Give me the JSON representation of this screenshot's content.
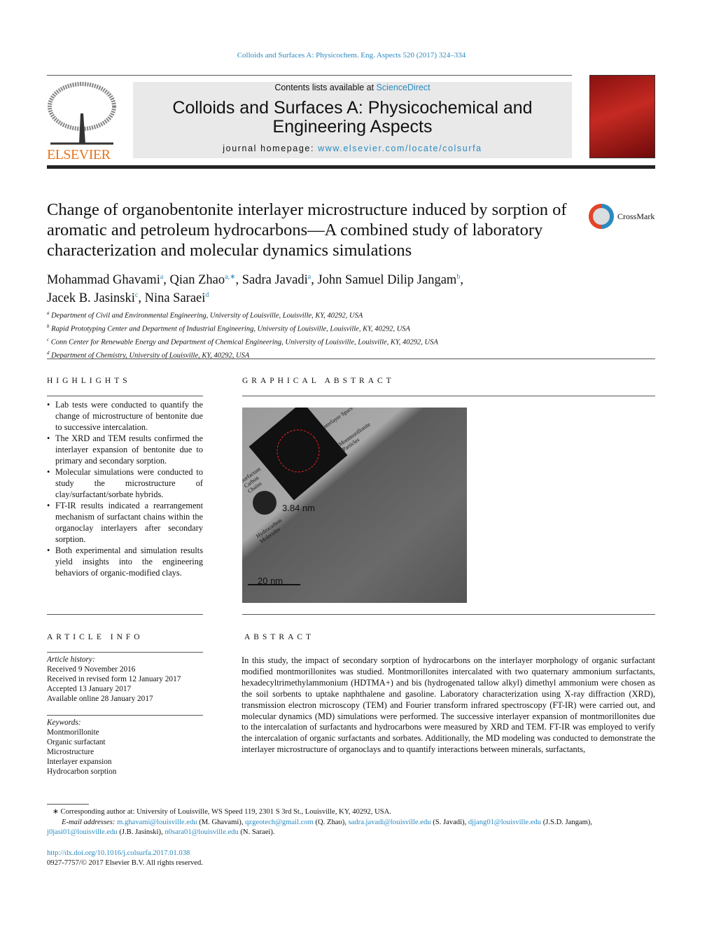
{
  "journal_ref": "Colloids and Surfaces A: Physicochem. Eng. Aspects 520 (2017) 324–334",
  "header": {
    "contents_prefix": "Contents lists available at ",
    "contents_link": "ScienceDirect",
    "journal_title": "Colloids and Surfaces A: Physicochemical and Engineering Aspects",
    "homepage_prefix": "journal homepage: ",
    "homepage_link": "www.elsevier.com/locate/colsurfa",
    "publisher_logo": "ELSEVIER"
  },
  "crossmark": "CrossMark",
  "title": "Change of organobentonite interlayer microstructure induced by sorption of aromatic and petroleum hydrocarbons—A combined study of laboratory characterization and molecular dynamics simulations",
  "authors": [
    {
      "name": "Mohammad Ghavami",
      "sup": "a"
    },
    {
      "name": "Qian Zhao",
      "sup": "a,∗"
    },
    {
      "name": "Sadra Javadi",
      "sup": "a"
    },
    {
      "name": "John Samuel Dilip Jangam",
      "sup": "b"
    },
    {
      "name": "Jacek B. Jasinski",
      "sup": "c"
    },
    {
      "name": "Nina Saraei",
      "sup": "d"
    }
  ],
  "affiliations": [
    {
      "sup": "a",
      "text": "Department of Civil and Environmental Engineering, University of Louisville, Louisville, KY, 40292, USA"
    },
    {
      "sup": "b",
      "text": "Rapid Prototyping Center and Department of Industrial Engineering, University of Louisville, Louisville, KY, 40292, USA"
    },
    {
      "sup": "c",
      "text": "Conn Center for Renewable Energy and Department of Chemical Engineering, University of Louisville, Louisville, KY, 40292, USA"
    },
    {
      "sup": "d",
      "text": "Department of Chemistry, University of Louisville, KY, 40292, USA"
    }
  ],
  "highlights": {
    "heading": "HIGHLIGHTS",
    "items": [
      "Lab tests were conducted to quantify the change of microstructure of bentonite due to successive intercalation.",
      "The XRD and TEM results confirmed the interlayer expansion of bentonite due to primary and secondary sorption.",
      "Molecular simulations were conducted to study the microstructure of clay/surfactant/sorbate hybrids.",
      "FT-IR results indicated a rearrangement mechanism of surfactant chains within the organoclay interlayers after secondary sorption.",
      "Both experimental and simulation results yield insights into the engineering behaviors of organic-modified clays."
    ]
  },
  "graphical_abstract": {
    "heading": "GRAPHICAL ABSTRACT",
    "labels": {
      "interlayer": "Interlayer Space",
      "particles": "Montmorillonite Particles",
      "chains": "Surfactant Carbon Chains",
      "hydrocarbon": "Hydrocarbon Molecules",
      "spacing": "3.84 nm",
      "scale": "20 nm"
    }
  },
  "article_info": {
    "heading": "ARTICLE INFO",
    "history_label": "Article history:",
    "history": [
      "Received 9 November 2016",
      "Received in revised form 12 January 2017",
      "Accepted 13 January 2017",
      "Available online 28 January 2017"
    ],
    "keywords_label": "Keywords:",
    "keywords": [
      "Montmorillonite",
      "Organic surfactant",
      "Microstructure",
      "Interlayer expansion",
      "Hydrocarbon sorption"
    ]
  },
  "abstract": {
    "heading": "ABSTRACT",
    "text": "In this study, the impact of secondary sorption of hydrocarbons on the interlayer morphology of organic surfactant modified montmorillonites was studied. Montmorillonites intercalated with two quaternary ammonium surfactants, hexadecyltrimethylammonium (HDTMA+) and bis (hydrogenated tallow alkyl) dimethyl ammonium were chosen as the soil sorbents to uptake naphthalene and gasoline. Laboratory characterization using X-ray diffraction (XRD), transmission electron microscopy (TEM) and Fourier transform infrared spectroscopy (FT-IR) were carried out, and molecular dynamics (MD) simulations were performed. The successive interlayer expansion of montmorillonites due to the intercalation of surfactants and hydrocarbons were measured by XRD and TEM. FT-IR was employed to verify the intercalation of organic surfactants and sorbates. Additionally, the MD modeling was conducted to demonstrate the interlayer microstructure of organoclays and to quantify interactions between minerals, surfactants,"
  },
  "footnote": {
    "corresponding": "∗ Corresponding author at: University of Louisville, WS Speed 119, 2301 S 3rd St., Louisville, KY, 40292, USA.",
    "email_label": "E-mail addresses:",
    "emails": [
      {
        "addr": "m.ghavami@louisville.edu",
        "who": " (M. Ghavami), "
      },
      {
        "addr": "qzgeotech@gmail.com",
        "who": " (Q. Zhao), "
      },
      {
        "addr": "sadra.javadi@louisville.edu",
        "who": " (S. Javadi), "
      },
      {
        "addr": "djjang01@louisville.edu",
        "who": " (J.S.D. Jangam), "
      },
      {
        "addr": "j0jasi01@louisville.edu",
        "who": " (J.B. Jasinski), "
      },
      {
        "addr": "n0sara01@louisville.edu",
        "who": " (N. Saraei)."
      }
    ],
    "doi": "http://dx.doi.org/10.1016/j.colsurfa.2017.01.038",
    "copyright": "0927-7757/© 2017 Elsevier B.V. All rights reserved."
  }
}
